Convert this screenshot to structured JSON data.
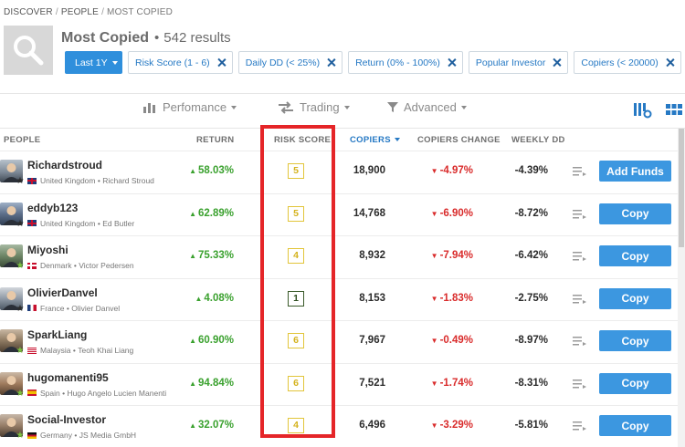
{
  "breadcrumb": [
    "DISCOVER",
    "PEOPLE",
    "MOST COPIED"
  ],
  "header": {
    "title": "Most Copied",
    "results_sep": "•",
    "results": "542 results"
  },
  "filters": {
    "period": "Last 1Y",
    "chips": [
      "Risk Score (1 - 6)",
      "Daily DD (< 25%)",
      "Return (0% - 100%)",
      "Popular Investor",
      "Copiers (< 20000)"
    ]
  },
  "tabs": [
    "Perfomance",
    "Trading",
    "Advanced"
  ],
  "columns": {
    "people": "PEOPLE",
    "return": "RETURN",
    "risk": "RISK SCORE",
    "copiers": "COPIERS",
    "change": "COPIERS CHANGE",
    "weekly": "WEEKLY DD"
  },
  "rows": [
    {
      "username": "Richardstroud",
      "country": "United Kingdom",
      "name": "Richard Stroud",
      "return": "58.03%",
      "risk": "5",
      "copiers": "18,900",
      "change": "-4.97%",
      "weekly": "-4.39%",
      "action": "Add Funds"
    },
    {
      "username": "eddyb123",
      "country": "United Kingdom",
      "name": "Ed Butler",
      "return": "62.89%",
      "risk": "5",
      "copiers": "14,768",
      "change": "-6.90%",
      "weekly": "-8.72%",
      "action": "Copy"
    },
    {
      "username": "Miyoshi",
      "country": "Denmark",
      "name": "Victor Pedersen",
      "return": "75.33%",
      "risk": "4",
      "copiers": "8,932",
      "change": "-7.94%",
      "weekly": "-6.42%",
      "action": "Copy"
    },
    {
      "username": "OlivierDanvel",
      "country": "France",
      "name": "Olivier Danvel",
      "return": "4.08%",
      "risk": "1",
      "copiers": "8,153",
      "change": "-1.83%",
      "weekly": "-2.75%",
      "action": "Copy"
    },
    {
      "username": "SparkLiang",
      "country": "Malaysia",
      "name": "Teoh Khai Liang",
      "return": "60.90%",
      "risk": "6",
      "copiers": "7,967",
      "change": "-0.49%",
      "weekly": "-8.97%",
      "action": "Copy"
    },
    {
      "username": "hugomanenti95",
      "country": "Spain",
      "name": "Hugo Angelo Lucien Manenti",
      "return": "94.84%",
      "risk": "6",
      "copiers": "7,521",
      "change": "-1.74%",
      "weekly": "-8.31%",
      "action": "Copy"
    },
    {
      "username": "Social-Investor",
      "country": "Germany",
      "name": "JS Media GmbH",
      "return": "32.07%",
      "risk": "4",
      "copiers": "6,496",
      "change": "-3.29%",
      "weekly": "-5.81%",
      "action": "Copy"
    }
  ],
  "dot": "•",
  "colors": {
    "accent": "#2f8fdc",
    "positive": "#3aa12e",
    "negative": "#d92b2b",
    "highlight": "#e52528"
  }
}
